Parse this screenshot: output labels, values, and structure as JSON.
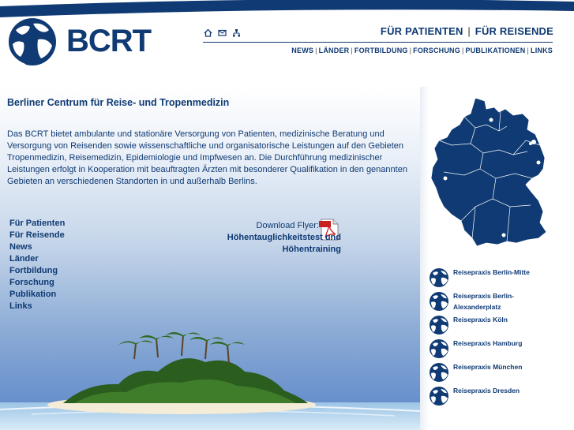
{
  "header": {
    "logo_text": "BCRT",
    "audience_1": "FÜR PATIENTEN",
    "audience_sep": "|",
    "audience_2": "FÜR REISENDE",
    "icons": [
      "home-icon",
      "mail-icon",
      "sitemap-icon"
    ],
    "topnav": [
      "NEWS",
      "LÄNDER",
      "FORTBILDUNG",
      "FORSCHUNG",
      "PUBLIKATIONEN",
      "LINKS"
    ]
  },
  "main": {
    "title": "Berliner Centrum für Reise- und Tropenmedizin",
    "intro": "Das BCRT bietet ambulante und stationäre Versorgung von Patienten, medizinische Beratung und Versorgung von Reisenden sowie wissenschaftliche und organisatorische Leistungen auf den Gebieten Tropenmedizin, Reisemedizin, Epidemiologie und Impfwesen an. Die Durchführung medizinischer Leistungen erfolgt in Kooperation mit beauftragten Ärzten mit besonderer Qualifikation in den genannten Gebieten an verschiedenen Standorten in und außerhalb Berlins.",
    "leftnav": [
      "Für Patienten",
      "Für Reisende",
      "News",
      "Länder",
      "Fortbildung",
      "Forschung",
      "Publikation",
      "Links"
    ],
    "download_label": "Download Flyer:",
    "download_link_1": "Höhentauglichkeitstest und",
    "download_link_2": "Höhentraining"
  },
  "sidebar": {
    "clinics": [
      {
        "label": "Reisepraxis Berlin-Mitte"
      },
      {
        "label": "Reisepraxis Berlin-Alexanderplatz"
      },
      {
        "label": "Reisepraxis Köln"
      },
      {
        "label": "Reisepraxis Hamburg"
      },
      {
        "label": "Reisepraxis München"
      },
      {
        "label": "Reisepraxis Dresden"
      }
    ]
  },
  "colors": {
    "brand_navy": "#0f3a73",
    "map_fill": "#0f3a73"
  }
}
